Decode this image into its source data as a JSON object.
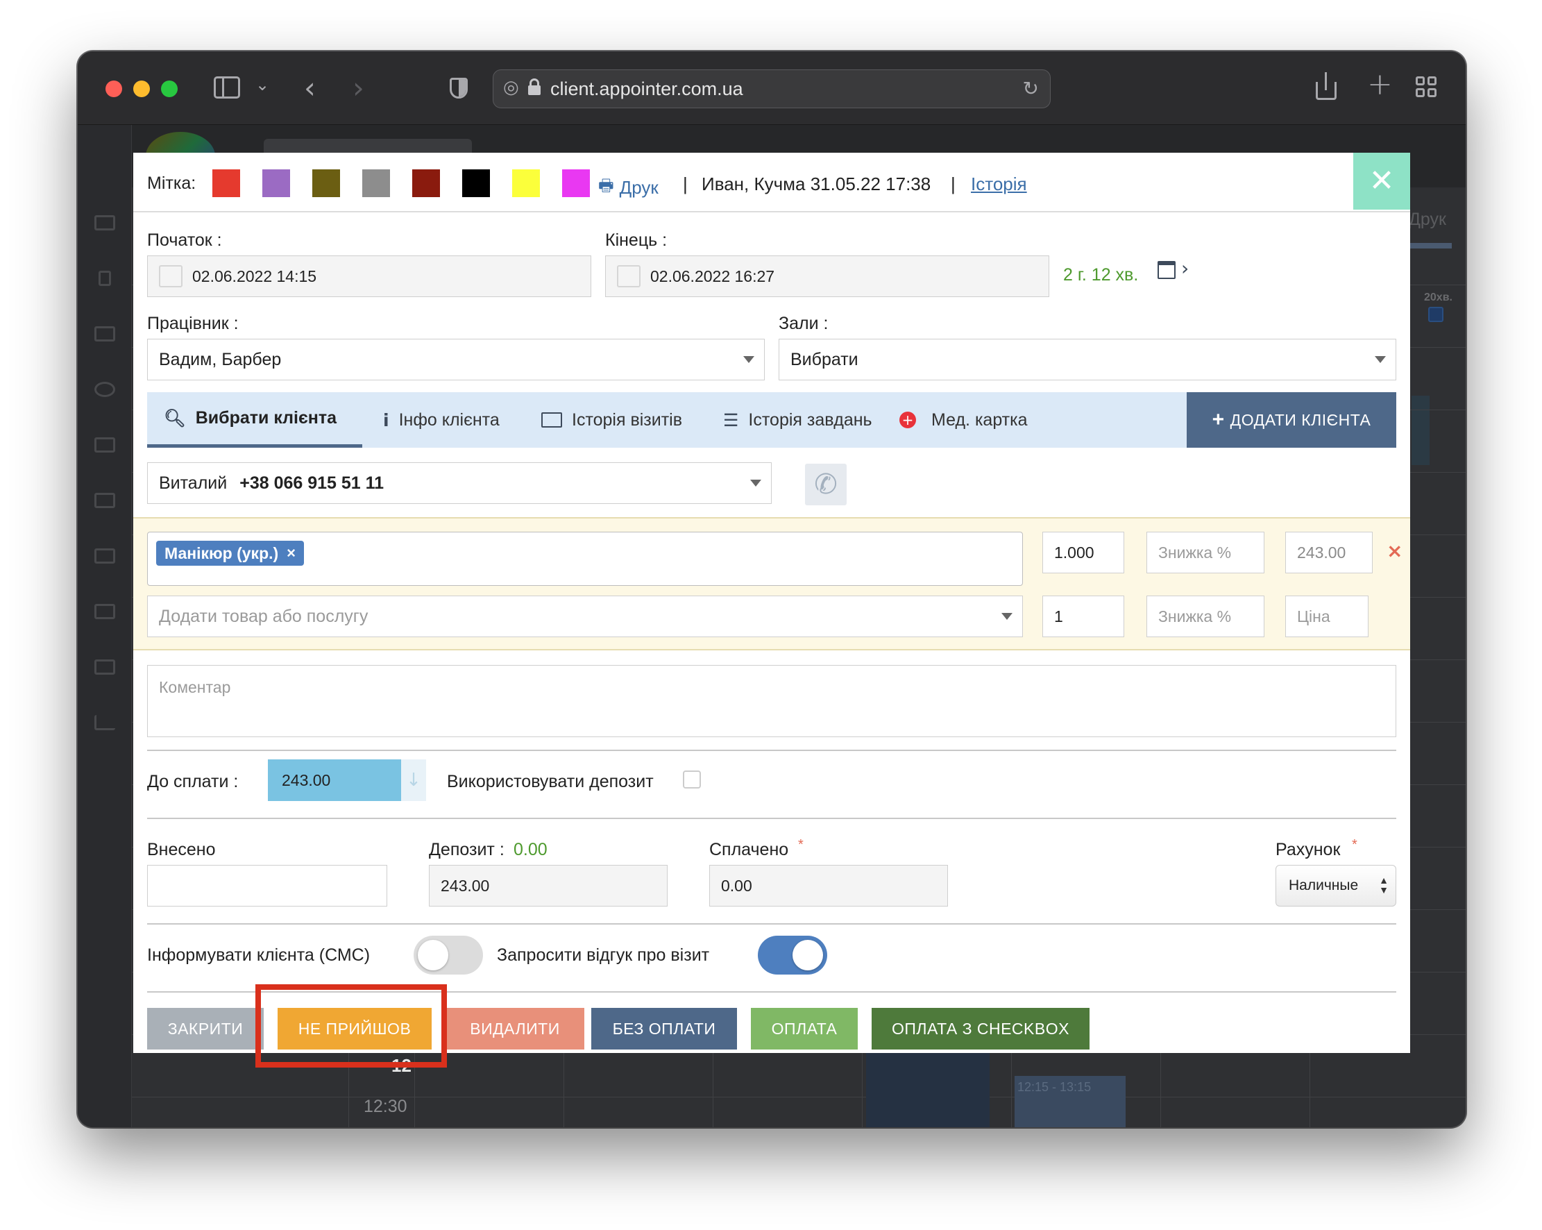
{
  "browser": {
    "url": "client.appointer.com.ua"
  },
  "modal": {
    "label_mark": "Мітка:",
    "mark_colors": [
      "#e53a2e",
      "#9b6bc3",
      "#6b5e12",
      "#8d8d8d",
      "#8a1b0e",
      "#000000",
      "#fbff3b",
      "#e938f2"
    ],
    "print_label": "Друк",
    "sep1": "|",
    "creator_info": "Иван, Кучма 31.05.22 17:38",
    "sep2": "|",
    "history_link": "Історія",
    "start": {
      "label": "Початок :",
      "value": "02.06.2022 14:15"
    },
    "end": {
      "label": "Кінець :",
      "value": "02.06.2022 16:27"
    },
    "duration": "2 г. 12 хв.",
    "worker": {
      "label": "Працівник :",
      "value": "Вадим, Барбер"
    },
    "halls": {
      "label": "Зали :",
      "value": "Вибрати"
    },
    "tabs": [
      {
        "label": "Вибрати клієнта",
        "icon": "search-icon"
      },
      {
        "label": "Інфо клієнта",
        "icon": "info-icon"
      },
      {
        "label": "Історія візитів",
        "icon": "id-card-icon"
      },
      {
        "label": "Історія завдань",
        "icon": "tasks-icon"
      },
      {
        "label": "Мед. картка",
        "icon": "plus-circle-icon"
      }
    ],
    "add_client_button": "ДОДАТИ КЛІЄНТА",
    "client": {
      "name": "Виталий",
      "phone": "+38 066 915 51 11"
    },
    "service": {
      "tag": "Манікюр (укр.)",
      "qty": "1.000",
      "discount_placeholder": "Знижка %",
      "price": "243.00"
    },
    "new_item": {
      "placeholder": "Додати товар або послугу",
      "qty": "1",
      "discount_placeholder": "Знижка %",
      "price_placeholder": "Ціна"
    },
    "comment_placeholder": "Коментар",
    "to_pay": {
      "label": "До сплати :",
      "value": "243.00"
    },
    "use_deposit_label": "Використовувати депозит",
    "paid_in": {
      "label": "Внесено",
      "value": ""
    },
    "deposit": {
      "label": "Депозит :",
      "amount": "0.00",
      "value": "243.00"
    },
    "paid": {
      "label": "Сплачено",
      "required": "*",
      "value": "0.00"
    },
    "account": {
      "label": "Рахунок",
      "required": "*",
      "value": "Наличные"
    },
    "sms_label": "Інформувати клієнта (СМС)",
    "sms_on": false,
    "feedback_label": "Запросити відгук про візит",
    "feedback_on": true,
    "buttons": {
      "close": "ЗАКРИТИ",
      "no_show": "НЕ ПРИЙШОВ",
      "delete": "ВИДАЛИТИ",
      "no_payment": "БЕЗ ОПЛАТИ",
      "payment": "ОПЛАТА",
      "payment_checkbox": "ОПЛАТА З CHECKBOX"
    }
  },
  "background": {
    "print_label": "Друк",
    "interval_label": "20хв.",
    "hour_label": "12",
    "time_label": "12:30",
    "event_label": "12:15 - 13:15"
  },
  "colors": {
    "accent": "#4e6889",
    "highlight": "#d9301c",
    "close_btn": "#a9b0b7",
    "no_show_btn": "#f0a733",
    "delete_btn": "#e8907a",
    "no_payment_btn": "#4e6889",
    "payment_btn": "#80b865",
    "payment_checkbox_btn": "#4e7a3b",
    "to_pay_bg": "#7ac3e2",
    "duration_green": "#4e9a2e"
  }
}
